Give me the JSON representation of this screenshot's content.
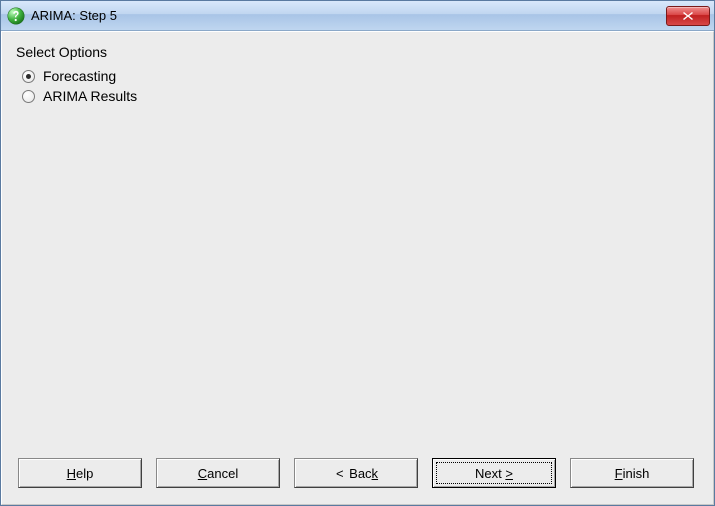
{
  "window": {
    "title": "ARIMA: Step 5"
  },
  "content": {
    "heading": "Select Options",
    "options": [
      {
        "label": "Forecasting",
        "selected": true
      },
      {
        "label": "ARIMA Results",
        "selected": false
      }
    ]
  },
  "buttons": {
    "help": {
      "pre": "",
      "hot": "H",
      "post": "elp"
    },
    "cancel": {
      "pre": "",
      "hot": "C",
      "post": "ancel"
    },
    "back": {
      "arrow": "<",
      "pre": " Bac",
      "hot": "k",
      "post": ""
    },
    "next": {
      "pre": "Next ",
      "hot": "",
      "post": "",
      "arrow": ">"
    },
    "finish": {
      "pre": "",
      "hot": "F",
      "post": "inish"
    }
  }
}
